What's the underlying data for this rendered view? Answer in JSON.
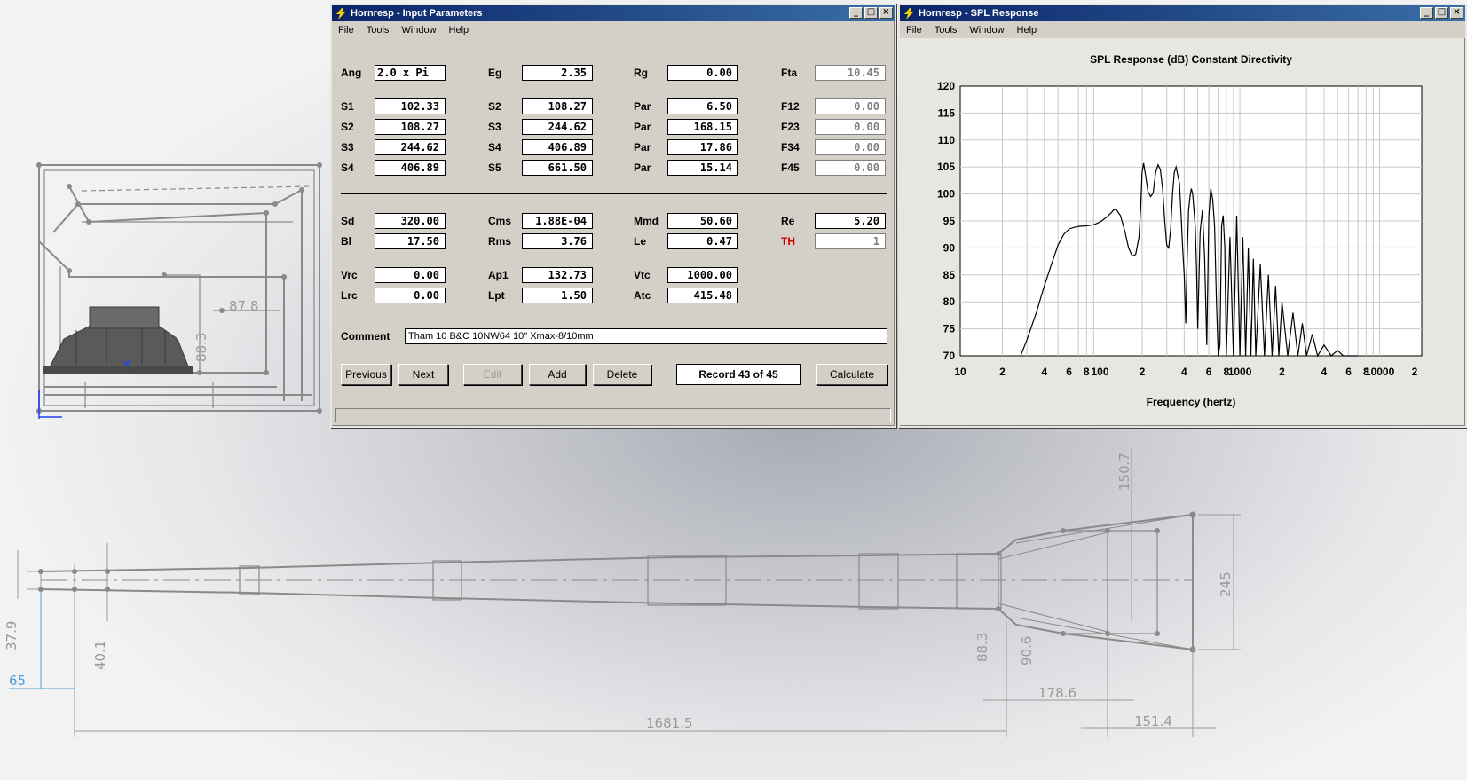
{
  "input_window": {
    "title": "Hornresp - Input Parameters",
    "menu": [
      "File",
      "Tools",
      "Window",
      "Help"
    ],
    "rows": [
      [
        {
          "label": "Ang",
          "value": "2.0 x Pi",
          "left": true
        },
        {
          "label": "Eg",
          "value": "2.35"
        },
        {
          "label": "Rg",
          "value": "0.00"
        },
        {
          "label": "Fta",
          "value": "10.45",
          "disabled": true
        }
      ],
      [
        {
          "label": "S1",
          "value": "102.33"
        },
        {
          "label": "S2",
          "value": "108.27"
        },
        {
          "label": "Par",
          "value": "6.50"
        },
        {
          "label": "F12",
          "value": "0.00",
          "disabled": true
        }
      ],
      [
        {
          "label": "S2",
          "value": "108.27"
        },
        {
          "label": "S3",
          "value": "244.62"
        },
        {
          "label": "Par",
          "value": "168.15"
        },
        {
          "label": "F23",
          "value": "0.00",
          "disabled": true
        }
      ],
      [
        {
          "label": "S3",
          "value": "244.62"
        },
        {
          "label": "S4",
          "value": "406.89"
        },
        {
          "label": "Par",
          "value": "17.86"
        },
        {
          "label": "F34",
          "value": "0.00",
          "disabled": true
        }
      ],
      [
        {
          "label": "S4",
          "value": "406.89"
        },
        {
          "label": "S5",
          "value": "661.50"
        },
        {
          "label": "Par",
          "value": "15.14"
        },
        {
          "label": "F45",
          "value": "0.00",
          "disabled": true
        }
      ],
      [
        {
          "label": "Sd",
          "value": "320.00"
        },
        {
          "label": "Cms",
          "value": "1.88E-04"
        },
        {
          "label": "Mmd",
          "value": "50.60"
        },
        {
          "label": "Re",
          "value": "5.20"
        }
      ],
      [
        {
          "label": "Bl",
          "value": "17.50"
        },
        {
          "label": "Rms",
          "value": "3.76"
        },
        {
          "label": "Le",
          "value": "0.47"
        },
        {
          "label": "TH",
          "value": "1",
          "disabled": true,
          "red": true
        }
      ],
      [
        {
          "label": "Vrc",
          "value": "0.00"
        },
        {
          "label": "Ap1",
          "value": "132.73"
        },
        {
          "label": "Vtc",
          "value": "1000.00"
        }
      ],
      [
        {
          "label": "Lrc",
          "value": "0.00"
        },
        {
          "label": "Lpt",
          "value": "1.50"
        },
        {
          "label": "Atc",
          "value": "415.48"
        }
      ]
    ],
    "comment_label": "Comment",
    "comment_value": "Tham 10 B&C 10NW64 10\"  Xmax-8/10mm",
    "buttons": {
      "previous": "Previous",
      "next": "Next",
      "edit": "Edit",
      "add": "Add",
      "delete": "Delete",
      "calculate": "Calculate"
    },
    "record": "Record 43 of 45"
  },
  "spl_window": {
    "title": "Hornresp - SPL Response",
    "menu": [
      "File",
      "Tools",
      "Window",
      "Help"
    ],
    "chart_title": "SPL Response (dB)   Constant Directivity"
  },
  "chart_data": {
    "type": "line",
    "title": "SPL Response (dB)   Constant Directivity",
    "xlabel": "Frequency (hertz)",
    "ylabel": "",
    "x_scale": "log",
    "xlim": [
      10,
      20000
    ],
    "ylim": [
      70,
      120
    ],
    "x_tick_labels": [
      "10",
      "2",
      "4",
      "6",
      "8",
      "100",
      "2",
      "4",
      "6",
      "8",
      "1000",
      "2",
      "4",
      "6",
      "8",
      "10000",
      "2"
    ],
    "y_tick_labels": [
      "120",
      "115",
      "110",
      "105",
      "100",
      "95",
      "90",
      "85",
      "80",
      "75",
      "70"
    ],
    "grid": true,
    "series": [
      {
        "x": [
          27,
          30,
          35,
          40,
          45,
          50,
          55,
          60,
          65,
          70,
          80,
          90,
          100,
          110,
          120,
          125,
          130,
          140,
          150,
          160,
          170,
          180,
          190,
          195,
          200,
          205,
          210,
          220,
          230,
          240,
          250,
          260,
          270,
          280,
          290,
          300,
          310,
          320,
          330,
          340,
          350,
          370,
          380,
          390,
          400,
          410,
          420,
          430,
          440,
          450,
          460,
          470,
          480,
          490,
          500,
          520,
          540,
          560,
          580,
          600,
          620,
          640,
          660,
          680,
          700,
          720,
          740,
          760,
          780,
          800,
          850,
          900,
          950,
          1000,
          1050,
          1100,
          1150,
          1200,
          1250,
          1300,
          1400,
          1500,
          1600,
          1700,
          1800,
          1900,
          2000,
          2200,
          2400,
          2600,
          2800,
          3000,
          3300,
          3600,
          4000,
          4500,
          5000,
          5500,
          6000,
          6500,
          7000
        ],
        "values": [
          70,
          73,
          78,
          83,
          87,
          90.5,
          92.5,
          93.5,
          93.8,
          94,
          94.1,
          94.3,
          94.8,
          95.6,
          96.5,
          97,
          97.2,
          96,
          93.2,
          90,
          88.5,
          88.8,
          92,
          97,
          104,
          105.7,
          104,
          100.5,
          99.5,
          100.2,
          104,
          105.4,
          104.5,
          101,
          95,
          90.5,
          90,
          93.5,
          100,
          104,
          105,
          102,
          96,
          90,
          85,
          76,
          88,
          97,
          99.5,
          101,
          100,
          97,
          94,
          86,
          75,
          93,
          97,
          88,
          72,
          96,
          101,
          99,
          94,
          80,
          70,
          72,
          94,
          96,
          90,
          70,
          92,
          70,
          96,
          70,
          92,
          70,
          90,
          70,
          88,
          70,
          87,
          70,
          85,
          70,
          83,
          70,
          80,
          70,
          78,
          70,
          76,
          70,
          74,
          70,
          72,
          70,
          71,
          70,
          70,
          70,
          70
        ]
      }
    ]
  },
  "cad_labels": {
    "d878": "87.8",
    "d883_top": "88.3",
    "d1507": "150.7",
    "d245": "245",
    "d379": "37.9",
    "d401": "40.1",
    "d65": "65",
    "d883": "88.3",
    "d906": "90.6",
    "d1786": "178.6",
    "d16815": "1681.5",
    "d1514": "151.4"
  }
}
